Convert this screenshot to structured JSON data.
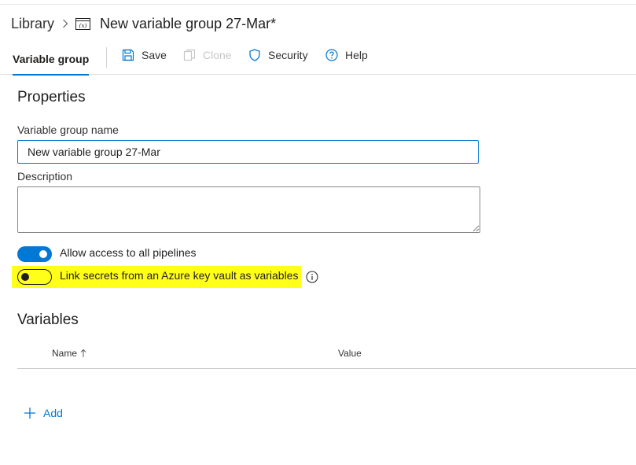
{
  "breadcrumb": {
    "library": "Library",
    "title": "New variable group 27-Mar*",
    "icon": "variable-group-icon"
  },
  "toolbar": {
    "tab_label": "Variable group",
    "save_label": "Save",
    "clone_label": "Clone",
    "security_label": "Security",
    "help_label": "Help"
  },
  "properties": {
    "heading": "Properties",
    "name_label": "Variable group name",
    "name_value": "New variable group 27-Mar",
    "description_label": "Description",
    "description_value": ""
  },
  "toggles": {
    "allow_access": {
      "label": "Allow access to all pipelines",
      "on": true
    },
    "link_secrets": {
      "label": "Link secrets from an Azure key vault as variables",
      "on": false,
      "highlight_color": "#ffff1a"
    }
  },
  "variables": {
    "heading": "Variables",
    "columns": {
      "name": "Name",
      "value": "Value"
    },
    "add_label": "Add"
  },
  "colors": {
    "accent": "#0078d4",
    "text": "#201f1e",
    "disabled": "#c8c6c4"
  }
}
